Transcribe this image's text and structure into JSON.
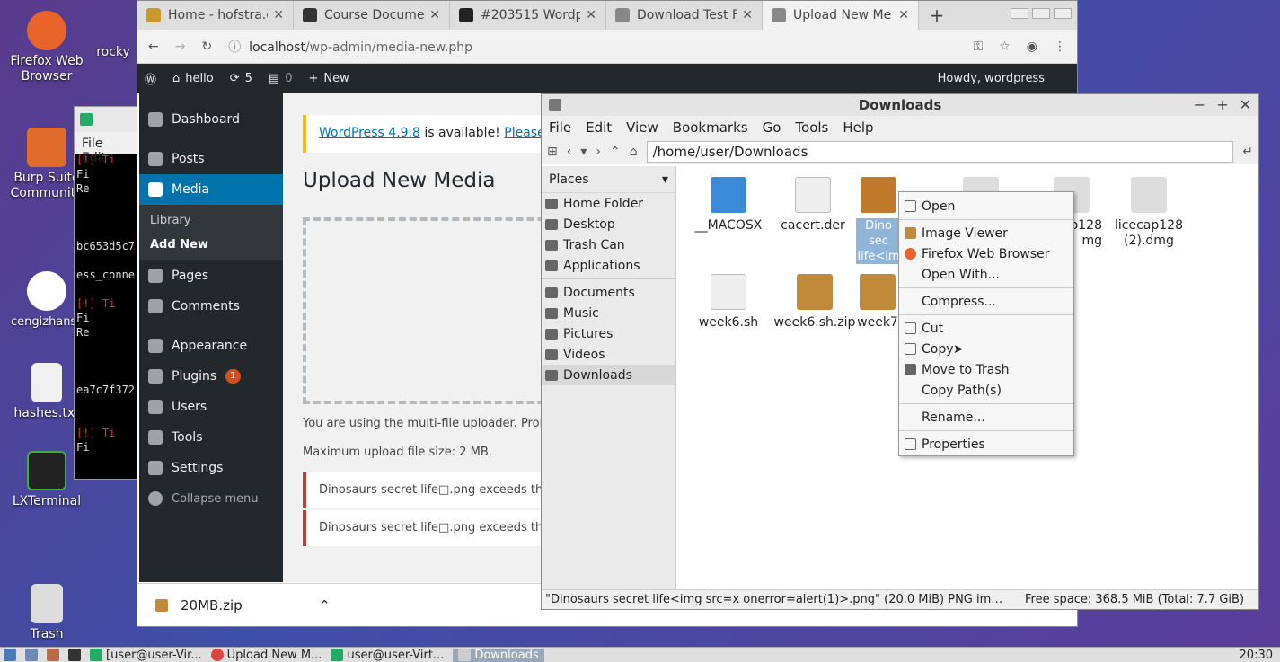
{
  "desktop": {
    "icons": [
      {
        "label": "Firefox Web Browser",
        "color": "#e8642a"
      },
      {
        "label": "rocky",
        "color": "#666666"
      },
      {
        "label": "Burp Suite Community",
        "color": "#e06b2a"
      },
      {
        "label": "cengizhansnsumofpwn",
        "color": "#ffffff"
      },
      {
        "label": "hashes.txt",
        "color": "#f0f0f0"
      },
      {
        "label": "LXTerminal",
        "color": "#222222"
      },
      {
        "label": "Trash",
        "color": "#dddddd"
      }
    ]
  },
  "terminal": {
    "menu": [
      "File",
      "Edit"
    ],
    "lines": [
      "[!] Ti",
      "Fi",
      "Re",
      "",
      "",
      "",
      "bc653d5c7",
      "",
      "ess_conne",
      "",
      "[!] Ti",
      "Fi",
      "Re",
      "",
      "",
      "",
      "ea7c7f372",
      "",
      "",
      "[!] Ti",
      "Fi"
    ]
  },
  "browser": {
    "tabs": [
      {
        "title": "Home - hofstra.e",
        "color": "#c79a2a"
      },
      {
        "title": "Course Docume",
        "color": "#333333"
      },
      {
        "title": "#203515 Wordp",
        "color": "#222222"
      },
      {
        "title": "Download Test F",
        "color": "#888888"
      },
      {
        "title": "Upload New Me",
        "color": "#888888",
        "active": true
      }
    ],
    "url_host": "localhost",
    "url_path": "/wp-admin/media-new.php",
    "download": "20MB.zip"
  },
  "wp": {
    "bar": {
      "site": "hello",
      "updates": "5",
      "comments": "0",
      "new": "New",
      "howdy": "Howdy, wordpress"
    },
    "menu": {
      "dashboard": "Dashboard",
      "posts": "Posts",
      "media": "Media",
      "library": "Library",
      "add_new": "Add New",
      "pages": "Pages",
      "comments": "Comments",
      "appearance": "Appearance",
      "plugins": "Plugins",
      "plugins_badge": "1",
      "users": "Users",
      "tools": "Tools",
      "settings": "Settings",
      "collapse": "Collapse menu"
    },
    "notice_link": "WordPress 4.9.8",
    "notice_text": " is available! ",
    "notice_link2": "Please up",
    "heading": "Upload New Media",
    "uploader_text": "You are using the multi-file uploader. Proble",
    "max_size": "Maximum upload file size: 2 MB.",
    "errors": [
      "Dinosaurs secret life□.png exceeds the m",
      "Dinosaurs secret life□.png exceeds the m"
    ]
  },
  "filemanager": {
    "title": "Downloads",
    "menu": [
      "File",
      "Edit",
      "View",
      "Bookmarks",
      "Go",
      "Tools",
      "Help"
    ],
    "path": "/home/user/Downloads",
    "places_header": "Places",
    "places": [
      "Home Folder",
      "Desktop",
      "Trash Can",
      "Applications"
    ],
    "places2": [
      "Documents",
      "Music",
      "Pictures",
      "Videos",
      "Downloads"
    ],
    "files": [
      {
        "name": "__MACOSX",
        "color": "#3a8ad8"
      },
      {
        "name": "cacert.der",
        "color": "#eeeeee"
      },
      {
        "name": "Dino sec life<im",
        "color": "#c0782a"
      },
      {
        "name": "",
        "color": "#dddddd"
      },
      {
        "name": "p128 mg",
        "color": "#dddddd"
      },
      {
        "name": "licecap128 (2).dmg",
        "color": "#dddddd"
      },
      {
        "name": "week6.sh",
        "color": "#eeeeee"
      },
      {
        "name": "week6.sh.zip",
        "color": "#c08a3a"
      },
      {
        "name": "week7",
        "color": "#c08a3a"
      }
    ],
    "status": "\"Dinosaurs secret life<img src=x onerror=alert(1)>.png\" (20.0 MiB) PNG im…",
    "free_space": "Free space: 368.5 MiB (Total: 7.7 GiB)"
  },
  "context_menu": {
    "open": "Open",
    "image_viewer": "Image Viewer",
    "firefox": "Firefox Web Browser",
    "open_with": "Open With...",
    "compress": "Compress...",
    "cut": "Cut",
    "copy": "Copy",
    "trash": "Move to Trash",
    "copy_paths": "Copy Path(s)",
    "rename": "Rename...",
    "properties": "Properties"
  },
  "taskbar": {
    "items": [
      "[user@user-Vir...",
      "Upload New M...",
      "user@user-Virt...",
      "Downloads"
    ],
    "clock": "20:30"
  }
}
